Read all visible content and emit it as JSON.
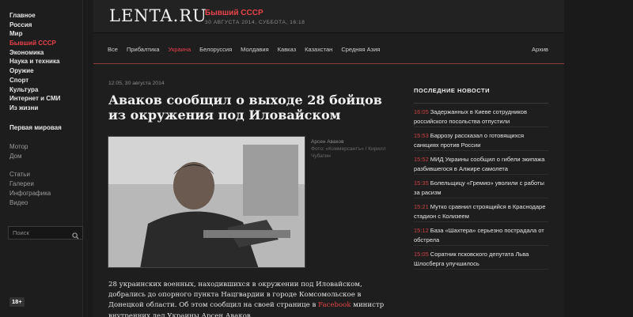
{
  "sidebar": {
    "main_items": [
      "Главное",
      "Россия",
      "Мир",
      "Бывший СССР",
      "Экономика",
      "Наука и техника",
      "Оружие",
      "Спорт",
      "Культура",
      "Интернет и СМИ",
      "Из жизни"
    ],
    "active_index": 3,
    "special": "Первая мировая",
    "group_a": [
      "Мотор",
      "Дом"
    ],
    "group_b": [
      "Статьи",
      "Галереи",
      "Инфографика",
      "Видео"
    ],
    "search_placeholder": "Поиск",
    "age_badge": "18+"
  },
  "header": {
    "logo": "LENTA.RU",
    "section": "Бывший СССР",
    "date": "30 АВГУСТА 2014, СУББОТА, 16:18"
  },
  "tabs": [
    "Все",
    "Прибалтика",
    "Украина",
    "Белоруссия",
    "Молдавия",
    "Кавказ",
    "Казахстан",
    "Средняя Азия"
  ],
  "active_tab": 2,
  "archive": "Архив",
  "article": {
    "timestamp": "12:05, 30 августа 2014",
    "headline": "Аваков сообщил о выходе 28 бойцов из окружения под Иловайском",
    "caption_name": "Арсен Аваков",
    "caption_credit": "Фото: «Коммерсантъ» / Кирилл Чубатин",
    "body_before": "28 украинских военных, находившихся в окружении под Иловайском, добрались до опорного пункта Нацгвардии в городе Комсомольское в Донецкой области. Об этом сообщил на своей странице в ",
    "body_link": "Facebook",
    "body_after": " министр внутренних дел Украины Арсен Аваков."
  },
  "news": {
    "title": "ПОСЛЕДНИЕ НОВОСТИ",
    "items": [
      {
        "time": "16:05",
        "text": "Задержанных в Киеве сотрудников российского посольства отпустили"
      },
      {
        "time": "15:53",
        "text": "Баррозу рассказал о готовящихся санкциях против России"
      },
      {
        "time": "15:52",
        "text": "МИД Украины сообщил о гибели экипажа разбившегося в Алжире самолета"
      },
      {
        "time": "15:35",
        "text": "Болельщицу «Гремио» уволили с работы за расизм"
      },
      {
        "time": "15:21",
        "text": "Мутко сравнил строящийся в Краснодаре стадион с Колизеем"
      },
      {
        "time": "15:12",
        "text": "База «Шахтера» серьезно пострадала от обстрела"
      },
      {
        "time": "15:05",
        "text": "Соратник псковского депутата Льва Шлосберга улучшилось"
      }
    ]
  },
  "colors": {
    "accent": "#e8424a",
    "background": "#1e1e1e"
  }
}
